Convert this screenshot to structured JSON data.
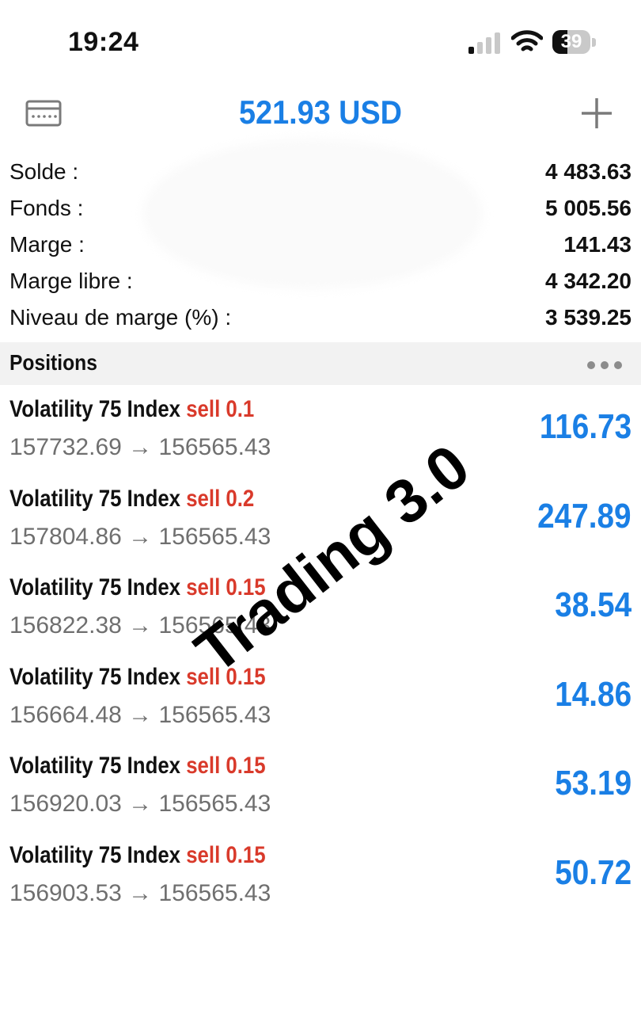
{
  "status_bar": {
    "time": "19:24",
    "battery": "39"
  },
  "header": {
    "balance_title": "521.93 USD"
  },
  "summary": [
    {
      "label": "Solde :",
      "value": "4 483.63"
    },
    {
      "label": "Fonds :",
      "value": "5 005.56"
    },
    {
      "label": "Marge :",
      "value": "141.43"
    },
    {
      "label": "Marge libre :",
      "value": "4 342.20"
    },
    {
      "label": "Niveau de marge (%) :",
      "value": "3 539.25"
    }
  ],
  "positions_section": {
    "title": "Positions"
  },
  "positions": [
    {
      "symbol": "Volatility 75 Index",
      "side": "sell 0.1",
      "prices": "157732.69 → 156565.43",
      "profit": "116.73"
    },
    {
      "symbol": "Volatility 75 Index",
      "side": "sell 0.2",
      "prices": "157804.86 → 156565.43",
      "profit": "247.89"
    },
    {
      "symbol": "Volatility 75 Index",
      "side": "sell 0.15",
      "prices": "156822.38 → 156565.43",
      "profit": "38.54"
    },
    {
      "symbol": "Volatility 75 Index",
      "side": "sell 0.15",
      "prices": "156664.48 → 156565.43",
      "profit": "14.86"
    },
    {
      "symbol": "Volatility 75 Index",
      "side": "sell 0.15",
      "prices": "156920.03 → 156565.43",
      "profit": "53.19"
    },
    {
      "symbol": "Volatility 75 Index",
      "side": "sell 0.15",
      "prices": "156903.53 → 156565.43",
      "profit": "50.72"
    }
  ],
  "watermark": "Trading 3.0",
  "colors": {
    "accent": "#1a7fe5",
    "sell": "#d93a2b",
    "section_bg": "#f2f2f2"
  }
}
